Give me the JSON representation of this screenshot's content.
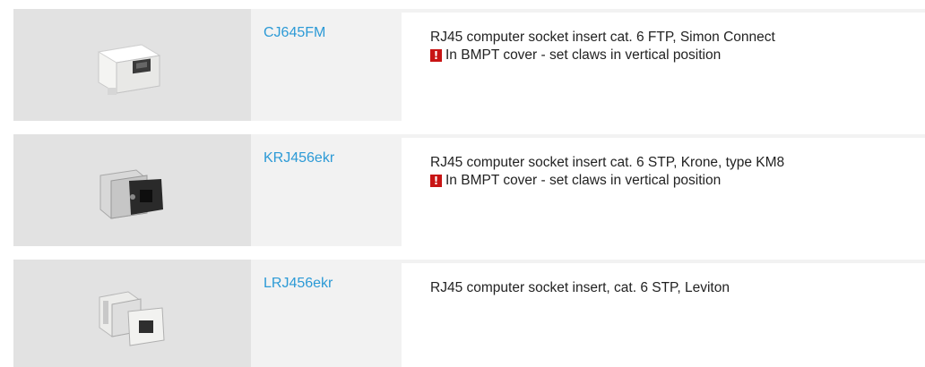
{
  "products": [
    {
      "code": "CJ645FM",
      "description": "RJ45 computer socket insert cat. 6 FTP, Simon Connect",
      "note": "In BMPT cover - set claws in vertical position",
      "image": "white-keystone-socket-image"
    },
    {
      "code": "KRJ456ekr",
      "description": "RJ45 computer socket insert cat. 6 STP, Krone, type KM8",
      "note": "In BMPT cover - set claws in vertical position",
      "image": "black-keystone-socket-image"
    },
    {
      "code": "LRJ456ekr",
      "description": "RJ45 computer socket insert, cat. 6 STP, Leviton",
      "note": null,
      "image": "metal-keystone-socket-image"
    }
  ],
  "warning_icon": "exclamation-icon",
  "colors": {
    "link": "#2c9ad6",
    "warning": "#c81414",
    "image_bg": "#e2e2e2",
    "code_bg": "#f2f2f2"
  }
}
